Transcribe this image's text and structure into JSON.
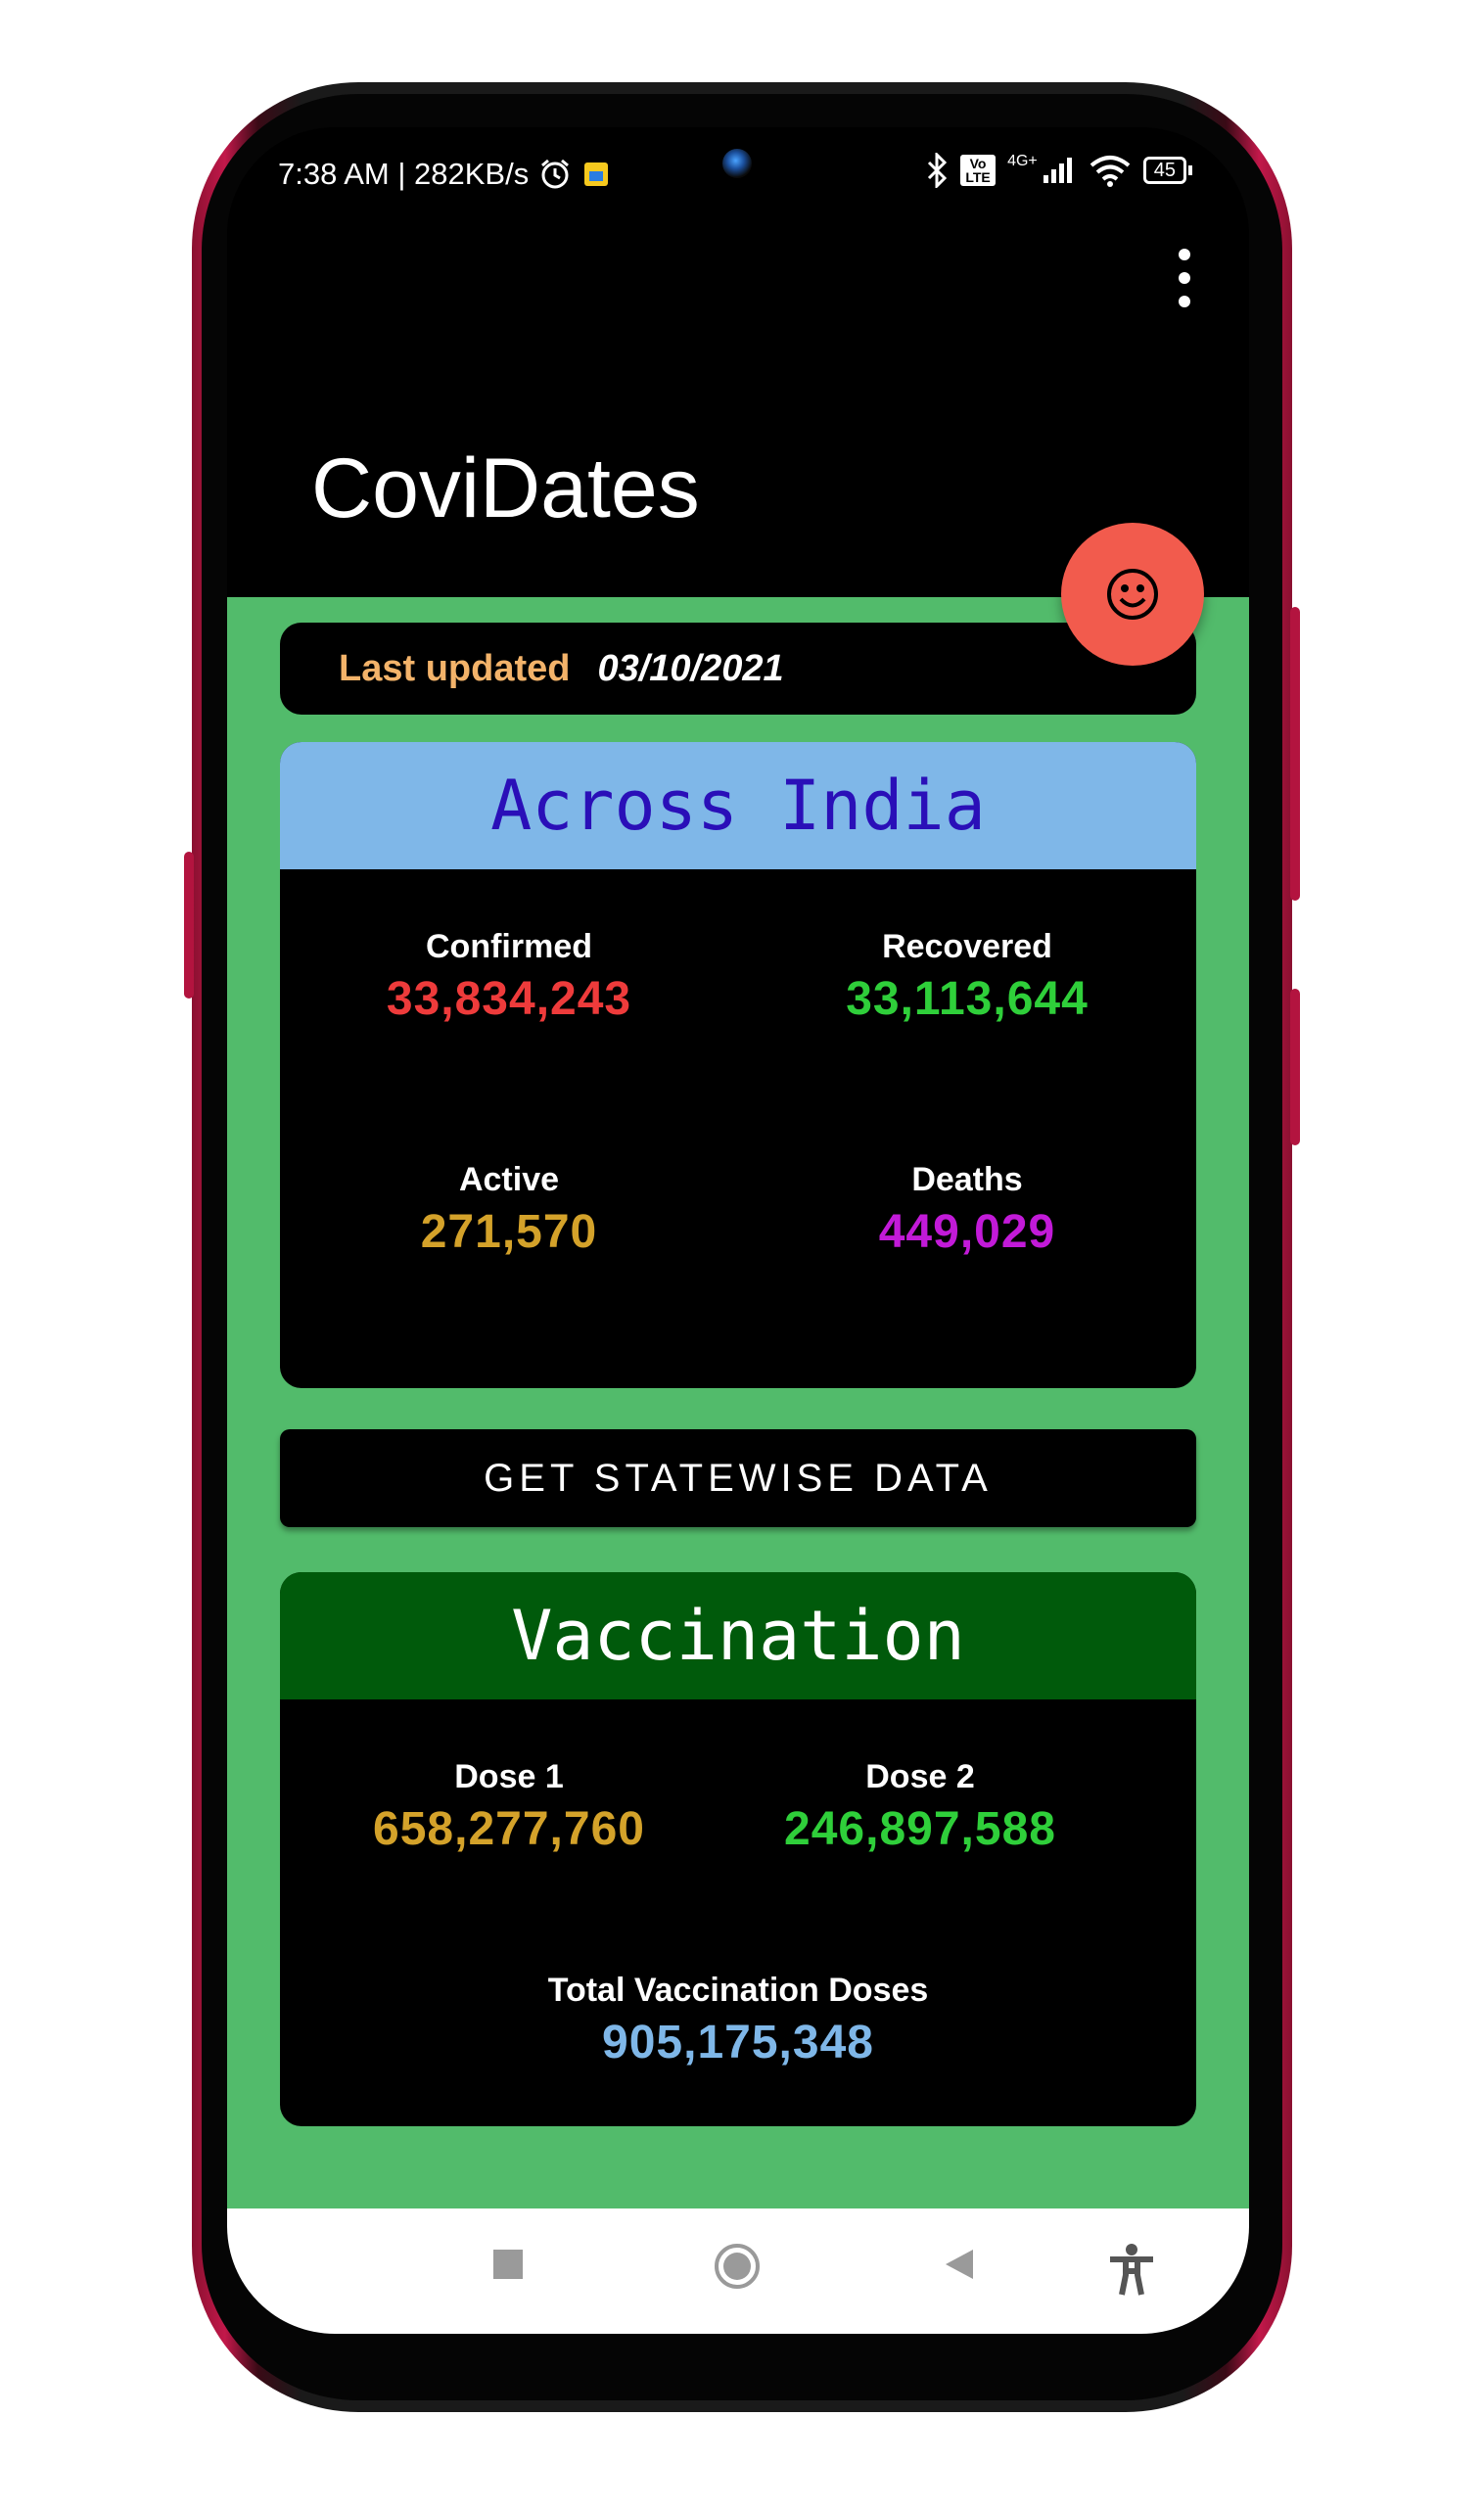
{
  "status_bar": {
    "time_speed": "7:38 AM | 282KB/s",
    "network_label": "4G+",
    "volte_label": "Vo LTE",
    "battery": "45"
  },
  "app": {
    "title": "CoviDates"
  },
  "last_updated": {
    "label": "Last updated",
    "date": "03/10/2021"
  },
  "india": {
    "header": "Across India",
    "confirmed": {
      "label": "Confirmed",
      "value": "33,834,243",
      "color": "#ee3b3b"
    },
    "recovered": {
      "label": "Recovered",
      "value": "33,113,644",
      "color": "#2fcf3a"
    },
    "active": {
      "label": "Active",
      "value": "271,570",
      "color": "#d4a22a"
    },
    "deaths": {
      "label": "Deaths",
      "value": "449,029",
      "color": "#c21ad8"
    }
  },
  "statewise_button": "GET STATEWISE DATA",
  "vaccination": {
    "header": "Vaccination",
    "dose1": {
      "label": "Dose 1",
      "value": "658,277,760",
      "color": "#d4a22a"
    },
    "dose2": {
      "label": "Dose 2",
      "value": "246,897,588",
      "color": "#2fcf3a"
    },
    "total": {
      "label": "Total Vaccination Doses",
      "value": "905,175,348",
      "color": "#7fb7e8"
    }
  },
  "colors": {
    "content_bg": "#52bb6b",
    "fab": "#f25b4d",
    "india_header_bg": "#7fb7e8",
    "vacc_header_bg": "#005a0b"
  },
  "icons": {
    "fab": "smiley-face-icon",
    "overflow": "more-vert-icon",
    "nav": [
      "square-recents-icon",
      "circle-home-icon",
      "triangle-back-icon",
      "accessibility-icon"
    ]
  }
}
